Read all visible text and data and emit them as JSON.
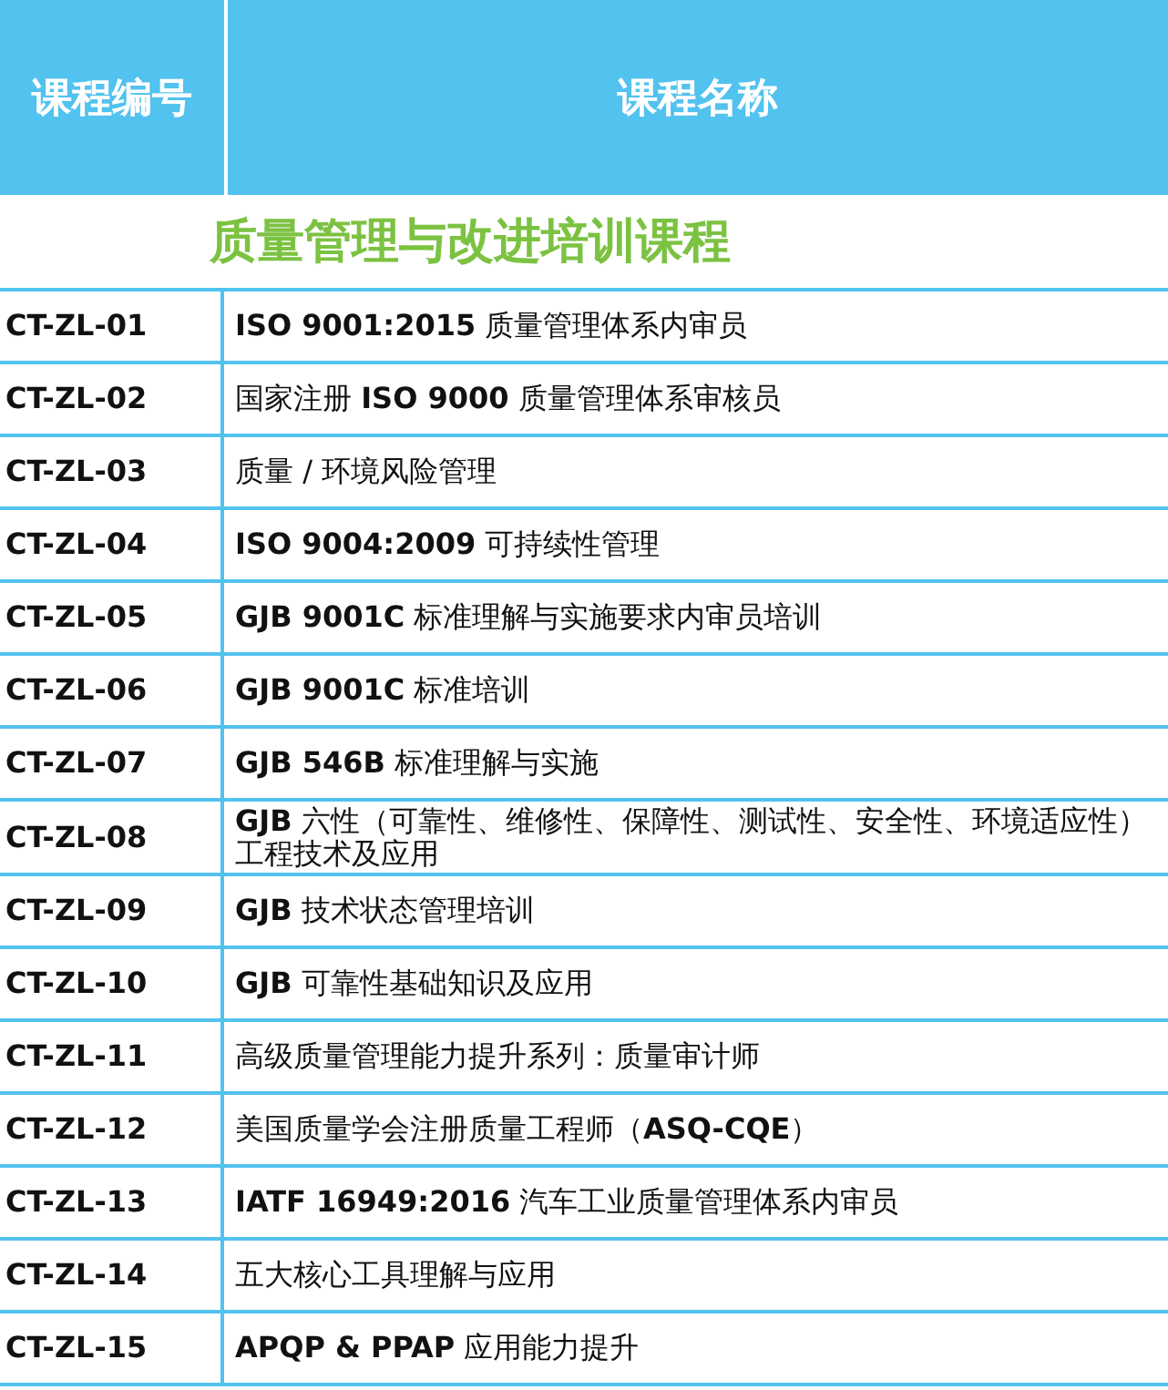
{
  "header": {
    "columns": [
      "课程编号",
      "课程名称"
    ]
  },
  "section_title": "质量管理与改进培训课程",
  "rows": [
    {
      "code": "CT-ZL-01",
      "name": "**ISO 9001:2015** 质量管理体系内审员"
    },
    {
      "code": "CT-ZL-02",
      "name": "国家注册 **ISO 9000** 质量管理体系审核员"
    },
    {
      "code": "CT-ZL-03",
      "name": "质量 / 环境风险管理"
    },
    {
      "code": "CT-ZL-04",
      "name": "**ISO 9004:2009** 可持续性管理"
    },
    {
      "code": "CT-ZL-05",
      "name": "**GJB 9001C** 标准理解与实施要求内审员培训"
    },
    {
      "code": "CT-ZL-06",
      "name": "**GJB 9001C** 标准培训"
    },
    {
      "code": "CT-ZL-07",
      "name": "**GJB 546B** 标准理解与实施"
    },
    {
      "code": "CT-ZL-08",
      "name": "**GJB** 六性（可靠性、维修性、保障性、测试性、安全性、环境适应性）工程技术及应用"
    },
    {
      "code": "CT-ZL-09",
      "name": "**GJB** 技术状态管理培训"
    },
    {
      "code": "CT-ZL-10",
      "name": "**GJB** 可靠性基础知识及应用"
    },
    {
      "code": "CT-ZL-11",
      "name": "高级质量管理能力提升系列：质量审计师"
    },
    {
      "code": "CT-ZL-12",
      "name": "美国质量学会注册质量工程师（**ASQ-CQE**）"
    },
    {
      "code": "CT-ZL-13",
      "name": "**IATF 16949:2016** 汽车工业质量管理体系内审员"
    },
    {
      "code": "CT-ZL-14",
      "name": "五大核心工具理解与应用"
    },
    {
      "code": "CT-ZL-15",
      "name": "**APQP & PPAP** 应用能力提升"
    }
  ]
}
